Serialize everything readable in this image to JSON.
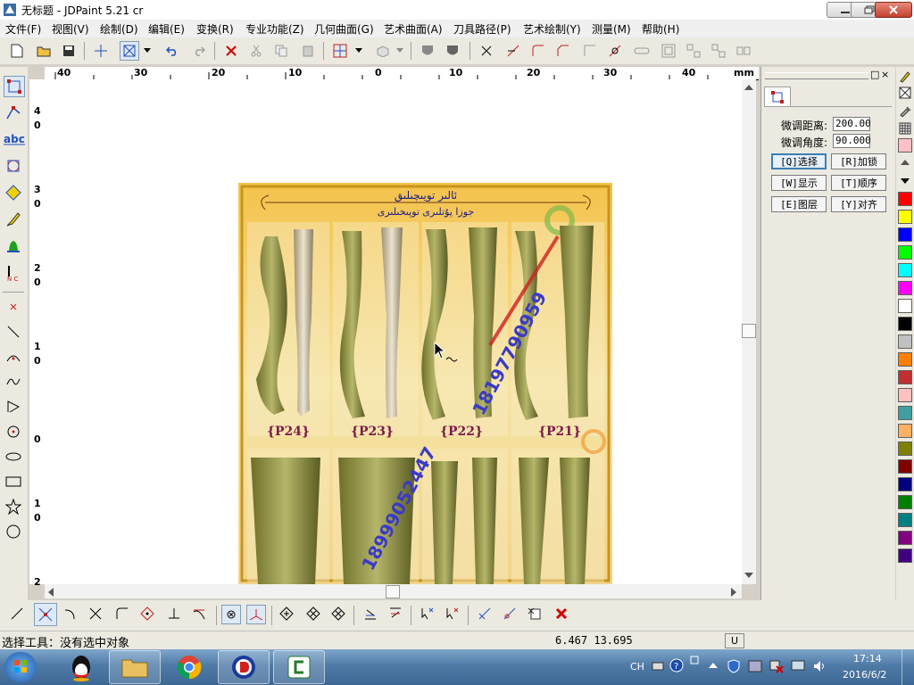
{
  "window": {
    "title": "无标题 - JDPaint 5.21 cr",
    "controls": {
      "minimize_icon": "minimize-icon",
      "maximize_icon": "restore-icon",
      "close_icon": "close-icon"
    }
  },
  "menu": [
    "文件(F)",
    "视图(V)",
    "绘制(D)",
    "编辑(E)",
    "变换(R)",
    "专业功能(Z)",
    "几何曲面(G)",
    "艺术曲面(A)",
    "刀具路径(P)",
    "艺术绘制(Y)",
    "测量(M)",
    "帮助(H)"
  ],
  "ruler": {
    "unit": "mm",
    "h_labels": [
      "40",
      "30",
      "20",
      "10",
      "0",
      "10",
      "20",
      "30",
      "40"
    ],
    "v_labels": [
      "4",
      "0",
      "3",
      "0",
      "2",
      "0",
      "1",
      "0",
      "0",
      "1",
      "0",
      "2"
    ]
  },
  "canvas_image": {
    "header_text_1": "ئالىر تويىچىلىق",
    "header_text_2": "جوزا پۇتلىرى توپىخىلىرى",
    "labels": [
      "{P24}",
      "{P23}",
      "{P22}",
      "{P21}"
    ],
    "watermark_number_1": "18197790959",
    "watermark_number_2": "18999052447"
  },
  "panel": {
    "tab_icon": "select-tool-icon",
    "fields": [
      {
        "label": "微调距离:",
        "value": "200.00"
      },
      {
        "label": "微调角度:",
        "value": "90.000"
      }
    ],
    "buttons": [
      {
        "label": "[Q]选择",
        "active": true
      },
      {
        "label": "[R]加锁",
        "active": false
      },
      {
        "label": "[W]显示",
        "active": false
      },
      {
        "label": "[T]顺序",
        "active": false
      },
      {
        "label": "[E]图层",
        "active": false
      },
      {
        "label": "[Y]对齐",
        "active": false
      }
    ]
  },
  "palette_colors": [
    "#ff0000",
    "#ffff00",
    "#0000ff",
    "#00ff00",
    "#00ffff",
    "#ff00ff",
    "#ffffff",
    "#000000",
    "#c0c0c0",
    "#ff8000",
    "#c03030",
    "#ffc0c0",
    "#3fa0a0",
    "#ffb060",
    "#808000",
    "#800000",
    "#000080",
    "#008000",
    "#008080",
    "#800080",
    "#400080"
  ],
  "status": {
    "text": "选择工具：没有选中对象",
    "coords": "6.467 13.695",
    "mode": "U"
  },
  "taskbar": {
    "apps": [
      "start-orb",
      "qq-icon",
      "explorer-icon",
      "chrome-icon",
      "jdpaint-icon",
      "camtasia-icon"
    ],
    "ime": "CH",
    "time": "17:14",
    "date": "2016/6/2"
  }
}
